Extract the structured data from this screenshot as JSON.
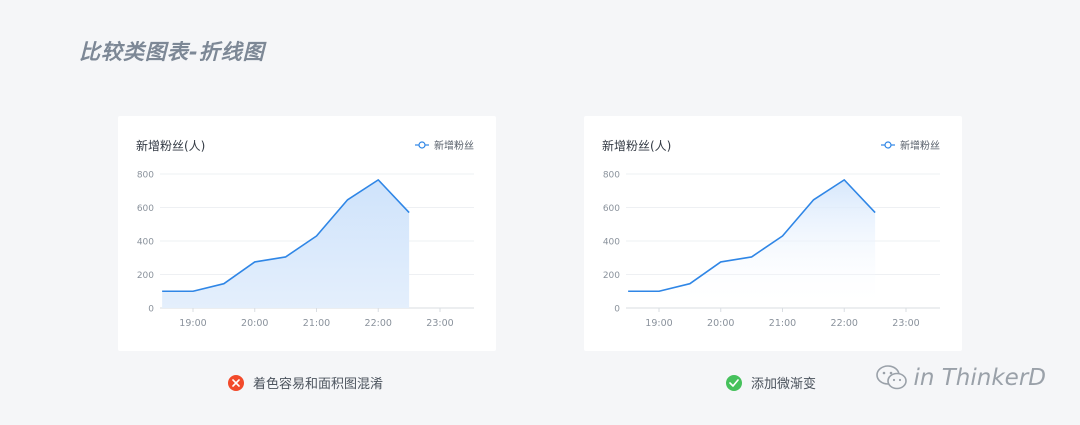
{
  "page": {
    "title": "比较类图表-折线图"
  },
  "cards": [
    {
      "title": "新增粉丝(人)",
      "legend": "新增粉丝",
      "fill": "solid"
    },
    {
      "title": "新增粉丝(人)",
      "legend": "新增粉丝",
      "fill": "gradient"
    }
  ],
  "captions": {
    "bad": "着色容易和面积图混淆",
    "good": "添加微渐变"
  },
  "colors": {
    "line": "#2f86e6",
    "bad_icon": "#f24a2b",
    "good_icon": "#46c15c"
  },
  "icons": {
    "bad": "close-icon",
    "good": "check-icon",
    "watermark": "wechat-icon"
  },
  "watermark": {
    "text": "in ThinkerD"
  },
  "chart_data": [
    {
      "type": "area",
      "title": "新增粉丝(人)",
      "series": [
        {
          "name": "新增粉丝",
          "values": [
            100,
            100,
            145,
            275,
            305,
            430,
            645,
            765,
            570
          ]
        }
      ],
      "x": [
        18.5,
        19.0,
        19.5,
        20.0,
        20.5,
        21.0,
        21.5,
        22.0,
        22.5
      ],
      "xticks": [
        "19:00",
        "20:00",
        "21:00",
        "22:00",
        "23:00"
      ],
      "yticks": [
        "0",
        "200",
        "400",
        "600",
        "800"
      ],
      "ylim": [
        0,
        800
      ],
      "grid": true,
      "legend": "top-right",
      "fill": "solid"
    },
    {
      "type": "area",
      "title": "新增粉丝(人)",
      "series": [
        {
          "name": "新增粉丝",
          "values": [
            100,
            100,
            145,
            275,
            305,
            430,
            645,
            765,
            570
          ]
        }
      ],
      "x": [
        18.5,
        19.0,
        19.5,
        20.0,
        20.5,
        21.0,
        21.5,
        22.0,
        22.5
      ],
      "xticks": [
        "19:00",
        "20:00",
        "21:00",
        "22:00",
        "23:00"
      ],
      "yticks": [
        "0",
        "200",
        "400",
        "600",
        "800"
      ],
      "ylim": [
        0,
        800
      ],
      "grid": true,
      "legend": "top-right",
      "fill": "gradient"
    }
  ]
}
